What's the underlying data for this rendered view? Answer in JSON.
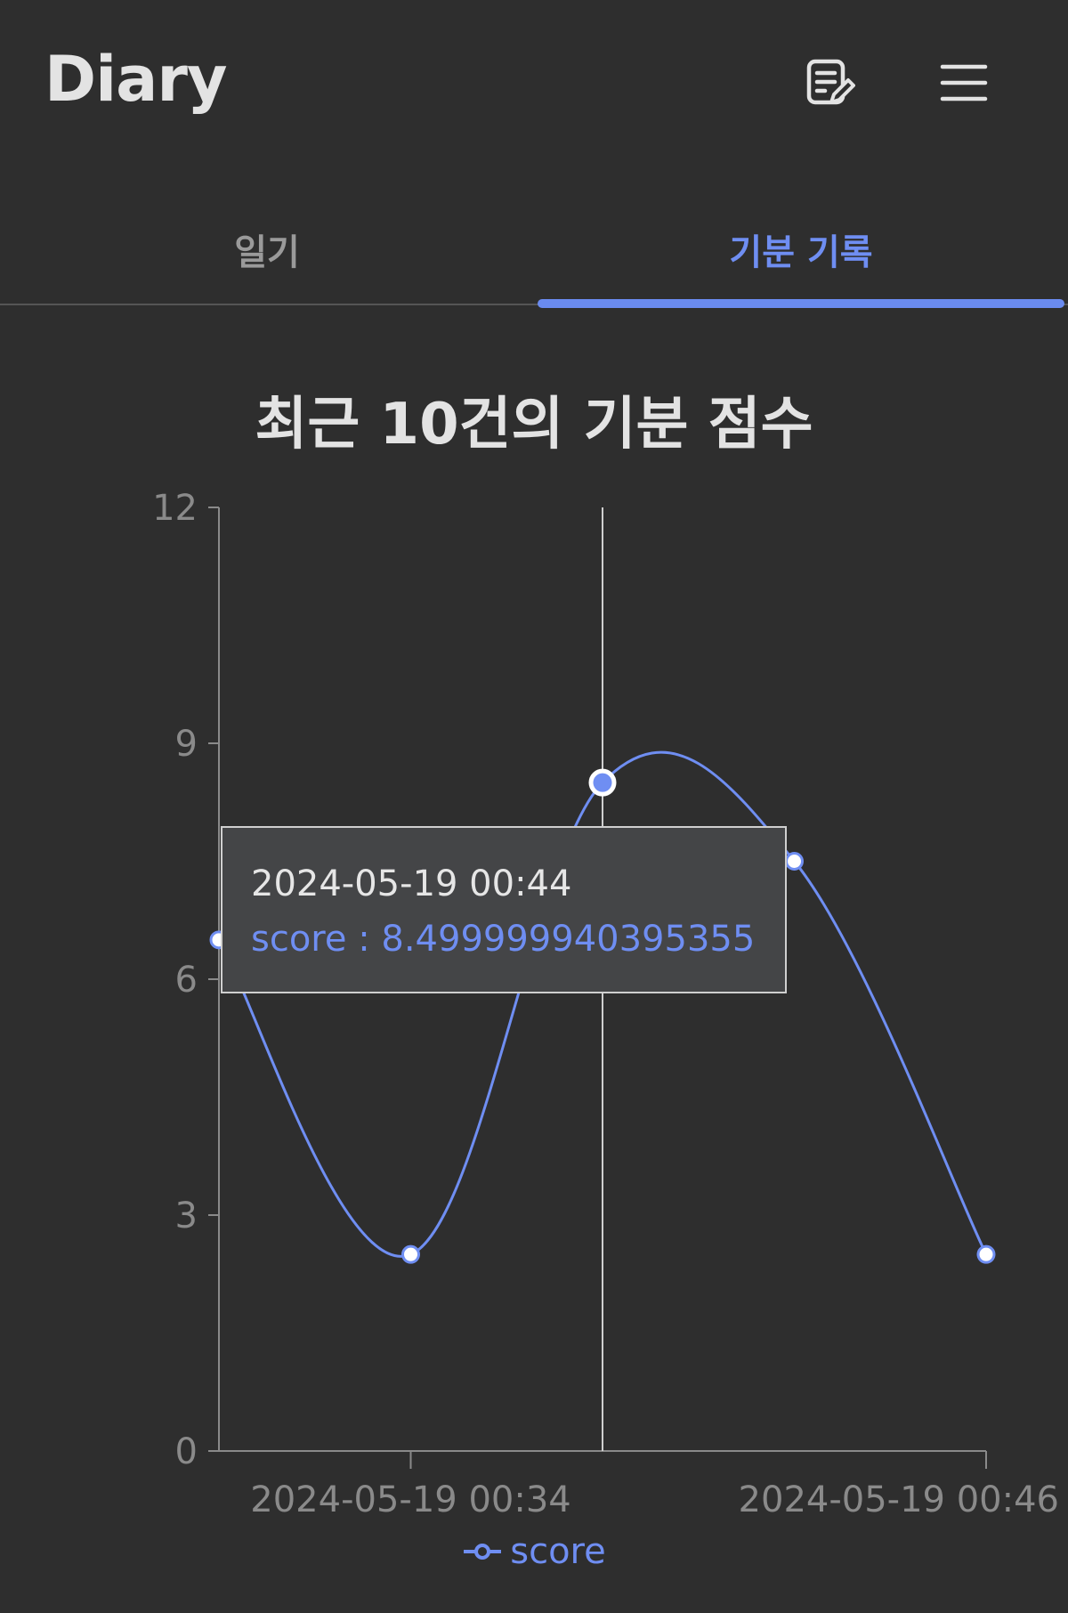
{
  "header": {
    "title": "Diary",
    "icons": [
      "write-diary-icon",
      "hamburger-menu-icon"
    ]
  },
  "tabs": [
    {
      "label": "일기",
      "selected": false
    },
    {
      "label": "기분 기록",
      "selected": true
    }
  ],
  "colors": {
    "accent": "#6f8ef2",
    "background": "#2e2e2e"
  },
  "chart": {
    "title": "최근 10건의 기분 점수",
    "tooltip": {
      "label": "2024-05-19 00:44",
      "value_text": "score : 8.499999940395355"
    },
    "legend": "score"
  },
  "chart_data": {
    "type": "line",
    "title": "최근 10건의 기분 점수",
    "series": [
      {
        "name": "score",
        "points": [
          {
            "x": "",
            "y": 6.5
          },
          {
            "x": "2024-05-19 00:34",
            "y": 2.5
          },
          {
            "x": "2024-05-19 00:44",
            "y": 8.499999940395355
          },
          {
            "x": "",
            "y": 7.5
          },
          {
            "x": "2024-05-19 00:46",
            "y": 2.5
          }
        ]
      }
    ],
    "x_tick_labels": [
      "2024-05-19 00:34",
      "2024-05-19 00:46"
    ],
    "y_ticks": [
      0,
      3,
      6,
      9,
      12
    ],
    "ylim": [
      0,
      12
    ],
    "grid": false,
    "legend": "bottom-center",
    "active_point": 2
  }
}
